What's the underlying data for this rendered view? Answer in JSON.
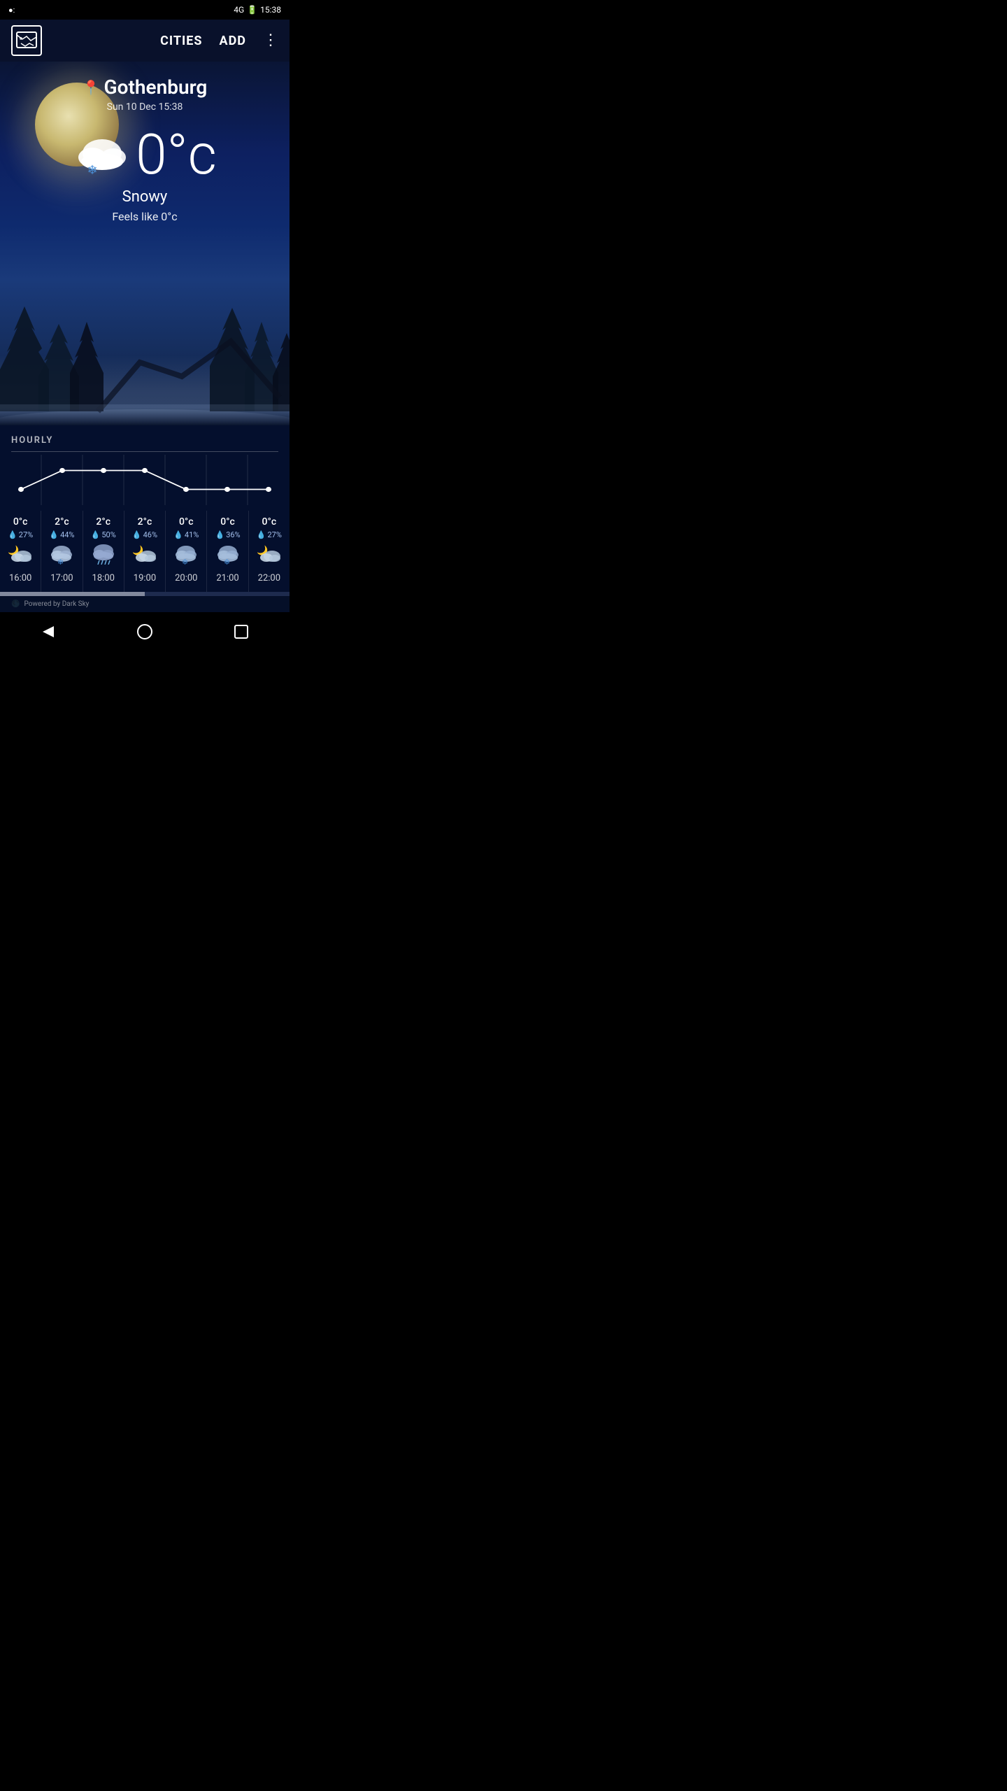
{
  "statusBar": {
    "left": "●:",
    "signal": "4G",
    "battery": "⚡",
    "time": "15:38"
  },
  "nav": {
    "citiesLabel": "CITIES",
    "addLabel": "ADD"
  },
  "weather": {
    "city": "Gothenburg",
    "date": "Sun 10 Dec 15:38",
    "temp": "0°c",
    "condition": "Snowy",
    "feelsLike": "Feels like 0°c"
  },
  "hourly": {
    "label": "HOURLY",
    "items": [
      {
        "temp": "0°c",
        "precip": "27%",
        "icon": "🌙☁",
        "time": "16:00"
      },
      {
        "temp": "2°c",
        "precip": "44%",
        "icon": "❄☁",
        "time": "17:00"
      },
      {
        "temp": "2°c",
        "precip": "50%",
        "icon": "🌧",
        "time": "18:00"
      },
      {
        "temp": "2°c",
        "precip": "46%",
        "icon": "🌙☁",
        "time": "19:00"
      },
      {
        "temp": "0°c",
        "precip": "41%",
        "icon": "❄☁",
        "time": "20:00"
      },
      {
        "temp": "0°c",
        "precip": "36%",
        "icon": "❄☁",
        "time": "21:00"
      },
      {
        "temp": "0°c",
        "precip": "27%",
        "icon": "🌙☁",
        "time": "22:00"
      }
    ]
  },
  "poweredBy": "Powered by Dark Sky"
}
